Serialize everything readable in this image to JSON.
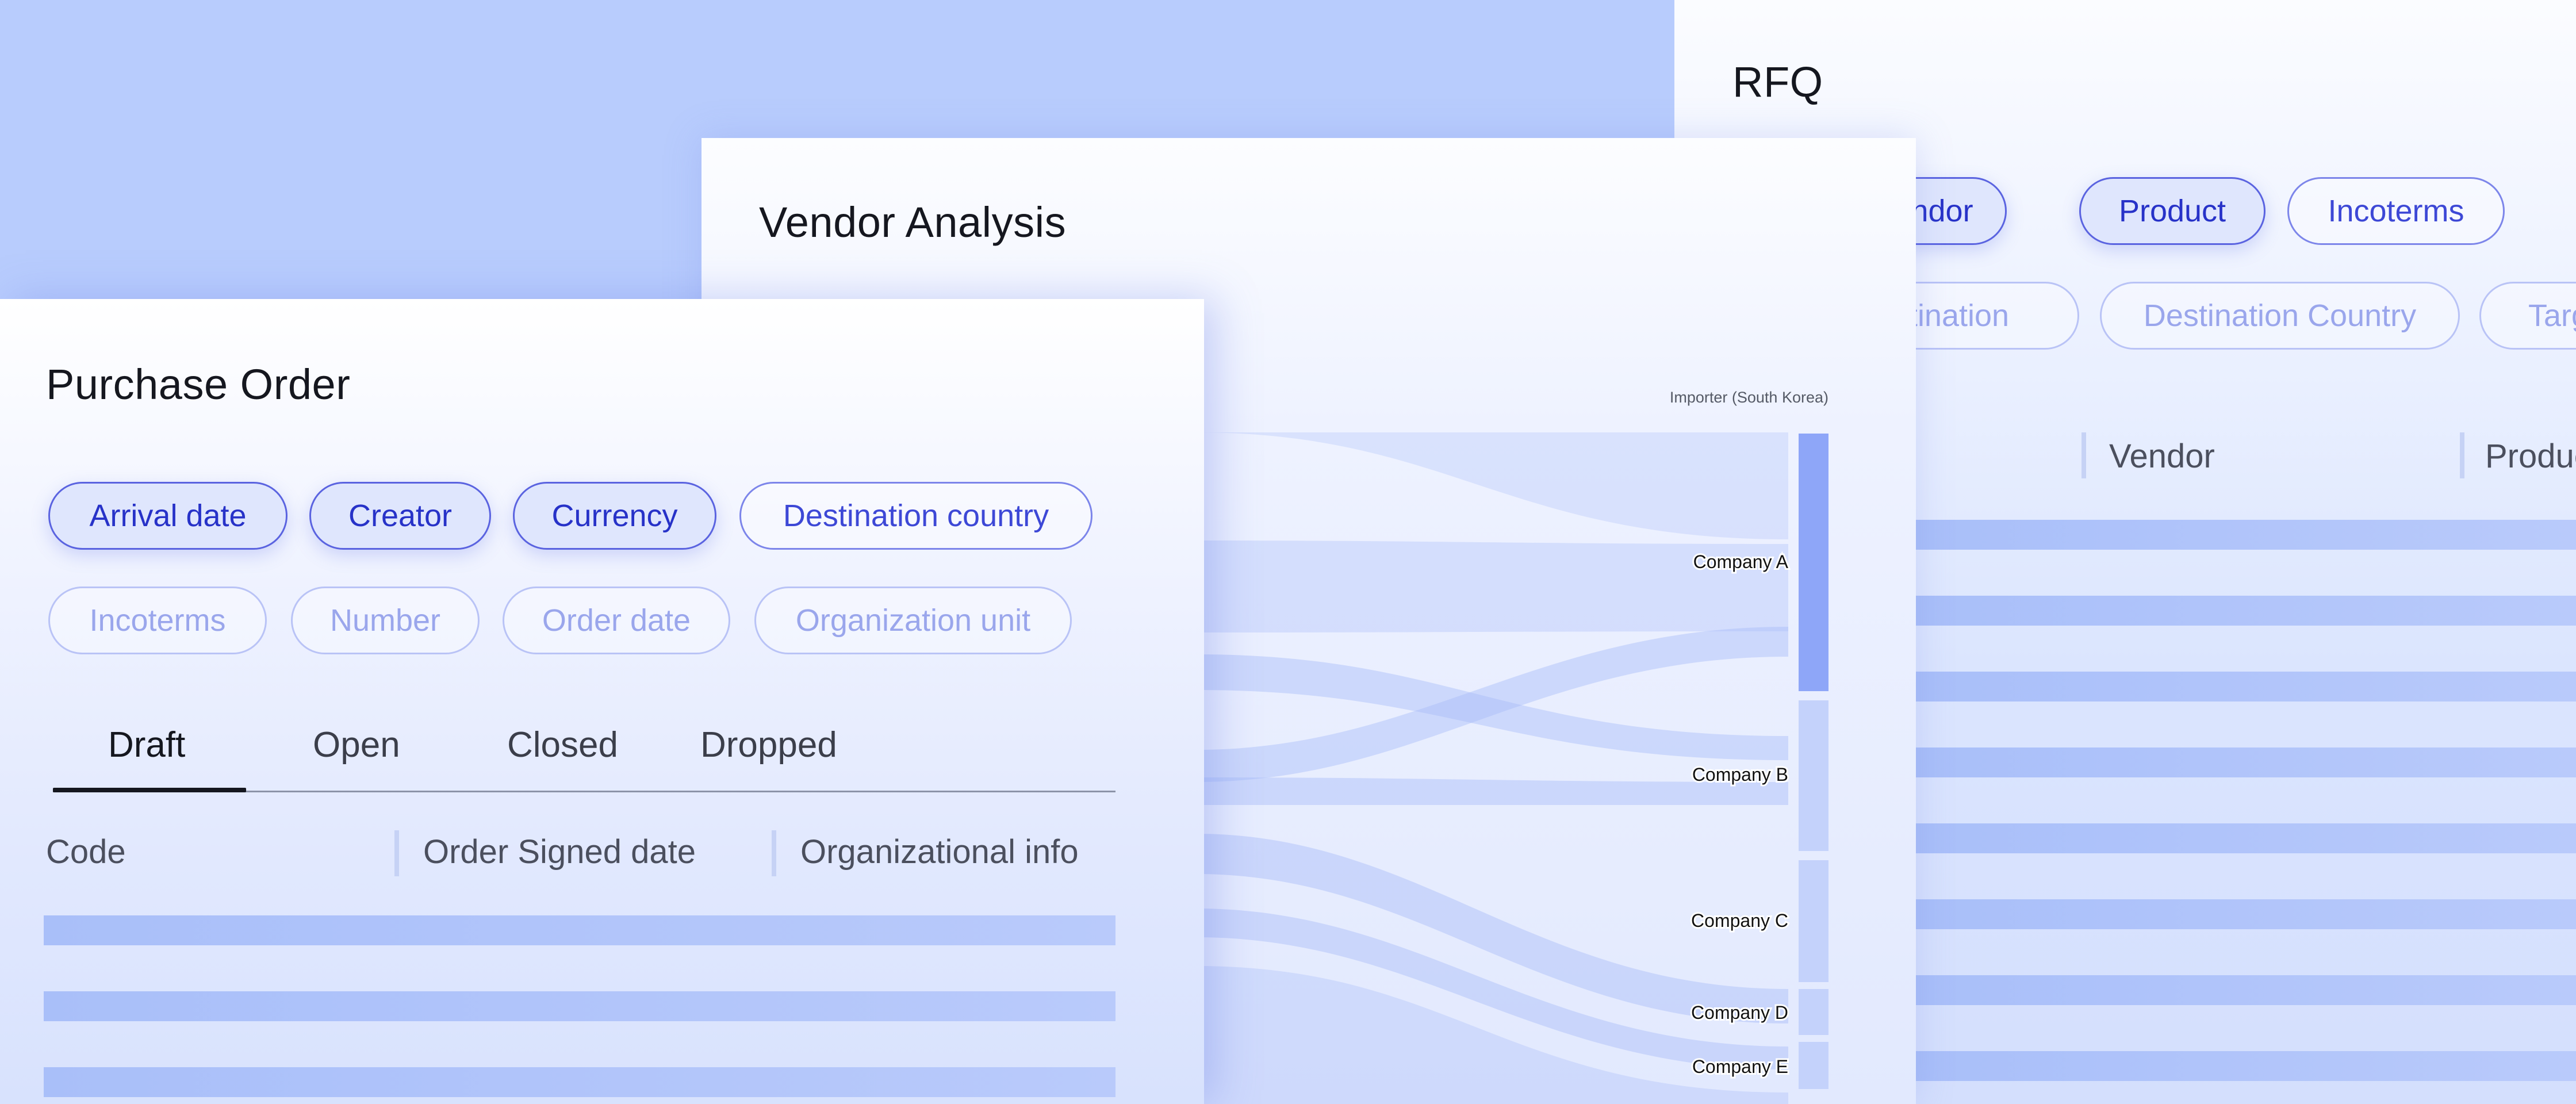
{
  "rfq": {
    "title": "RFQ",
    "chips_row1": [
      "Vendor",
      "Product",
      "Incoterms"
    ],
    "chips_row2": [
      "Destination",
      "Destination Country",
      "Target"
    ],
    "columns": [
      "Vendor",
      "Product"
    ]
  },
  "vendor_analysis": {
    "title": "Vendor Analysis",
    "chart_data": {
      "type": "sankey",
      "target_header": "Importer (South Korea)",
      "nodes": [
        "Company A",
        "Company B",
        "Company C",
        "Company D",
        "Company E"
      ]
    }
  },
  "purchase_order": {
    "title": "Purchase Order",
    "chips_selected": [
      "Arrival date",
      "Creator",
      "Currency"
    ],
    "chips_unselected": [
      "Destination country"
    ],
    "chips_faint": [
      "Incoterms",
      "Number",
      "Order date",
      "Organization unit"
    ],
    "tabs": [
      "Draft",
      "Open",
      "Closed",
      "Dropped"
    ],
    "active_tab": "Draft",
    "columns": [
      "Code",
      "Order Signed date",
      "Organizational info"
    ]
  },
  "colors": {
    "background": "#b8ccfd",
    "chip_selected_border": "#5a63e0",
    "chip_text": "#2732c8",
    "node_bar": "#8ea6f8",
    "row_bar": "#a9bff9"
  }
}
